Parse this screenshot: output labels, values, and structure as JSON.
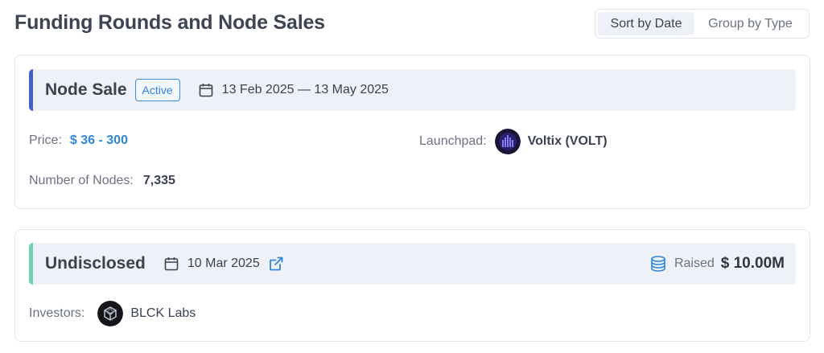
{
  "header": {
    "title": "Funding Rounds and Node Sales",
    "sort_options": [
      "Sort by Date",
      "Group by Type"
    ],
    "active_sort": "Sort by Date"
  },
  "cards": [
    {
      "title": "Node Sale",
      "badge": "Active",
      "date_range": "13 Feb 2025 — 13 May 2025",
      "accent_color": "#4a5ec9",
      "price_label": "Price:",
      "price_value": "$ 36 - 300",
      "launchpad_label": "Launchpad:",
      "launchpad_name": "Voltix (VOLT)",
      "nodes_label": "Number of Nodes:",
      "nodes_value": "7,335"
    },
    {
      "title": "Undisclosed",
      "date": "10 Mar 2025",
      "accent_color": "#6fd2b5",
      "raised_label": "Raised",
      "raised_value": "$ 10.00M",
      "investors_label": "Investors:",
      "investor_name": "BLCK Labs"
    }
  ],
  "icons": {
    "calendar": "calendar-icon",
    "external_link": "external-link-icon",
    "coins": "coins-icon"
  },
  "colors": {
    "link_blue": "#2f86d8",
    "panel_bg": "#eef2f8"
  }
}
